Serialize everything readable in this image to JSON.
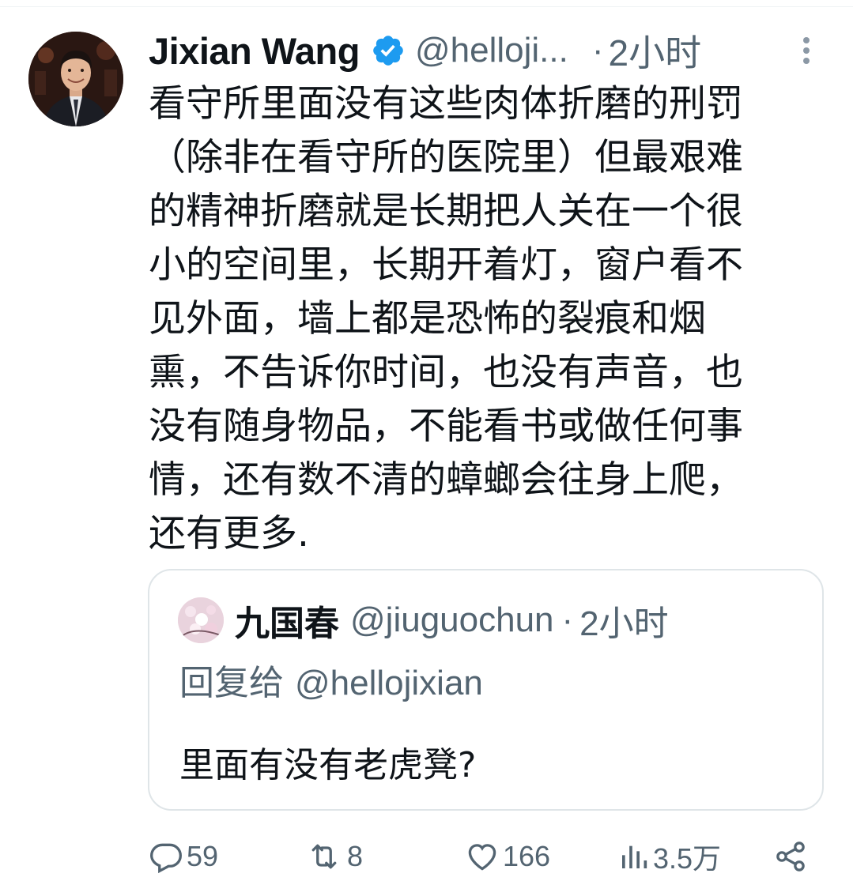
{
  "tweet": {
    "author_name": "Jixian Wang",
    "verified_icon": "verified-badge-icon",
    "handle": "@helloji...",
    "separator": "·",
    "time": "2小时",
    "text": "看守所里面没有这些肉体折磨的刑罚\n（除非在看守所的医院里）但最艰难\n的精神折磨就是长期把人关在一个很\n小的空间里，长期开着灯，窗户看不\n见外面，墙上都是恐怖的裂痕和烟\n熏，不告诉你时间，也没有声音，也\n没有随身物品，不能看书或做任何事\n情，还有数不清的蟑螂会往身上爬，\n还有更多."
  },
  "quote": {
    "name": "九国春",
    "handle": "@jiuguochun",
    "separator": "·",
    "time": "2小时",
    "reply_prefix": "回复给",
    "reply_handle": "@hellojixian",
    "text": "里面有没有老虎凳?"
  },
  "actions": {
    "replies": "59",
    "retweets": "8",
    "likes": "166",
    "views": "3.5万"
  },
  "colors": {
    "text_primary": "#0f1419",
    "text_secondary": "#536471",
    "verified_blue": "#1d9bf0",
    "border": "#dfe5e8"
  }
}
